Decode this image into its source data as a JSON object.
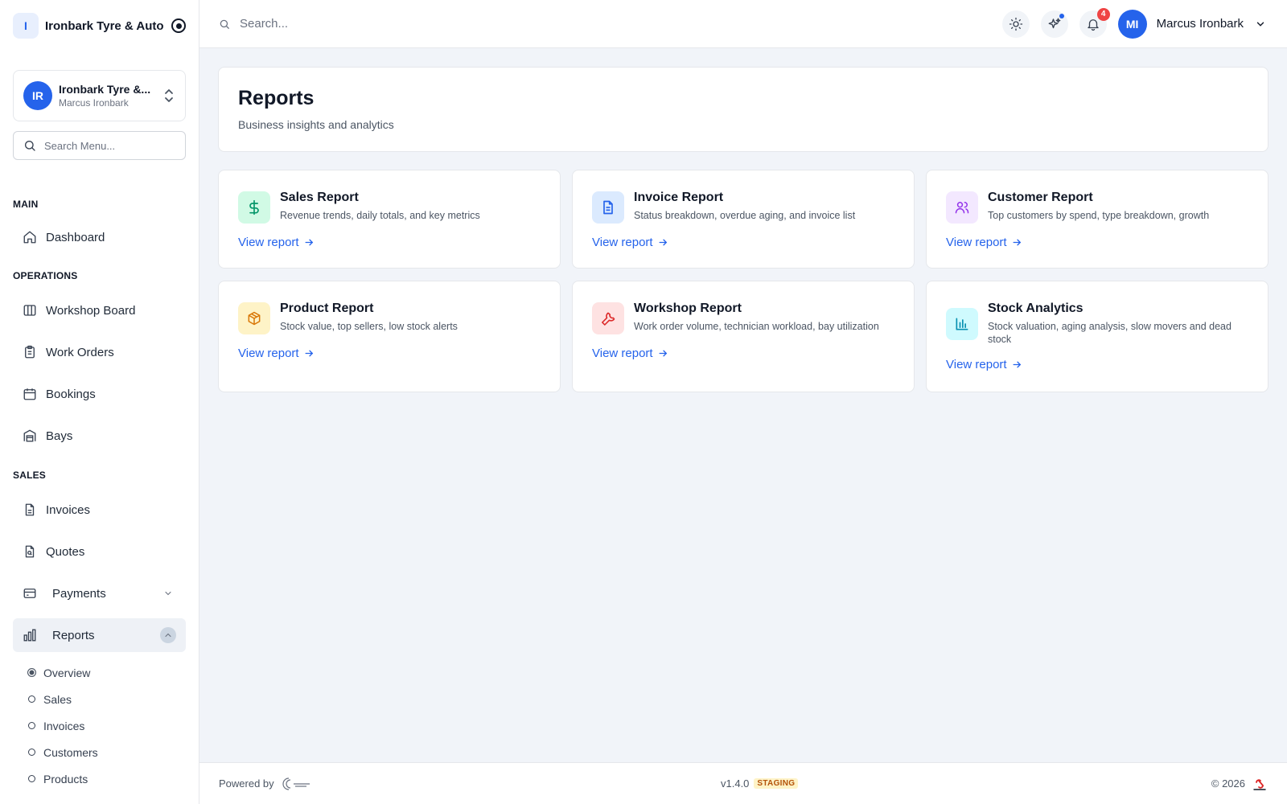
{
  "brand": {
    "logo_letter": "I",
    "name": "Ironbark Tyre & Auto"
  },
  "org_switcher": {
    "initials": "IR",
    "name": "Ironbark Tyre &...",
    "user": "Marcus Ironbark"
  },
  "menu_search": {
    "placeholder": "Search Menu..."
  },
  "sidebar": {
    "sections": {
      "main": "MAIN",
      "operations": "OPERATIONS",
      "sales": "SALES"
    },
    "items": {
      "dashboard": "Dashboard",
      "workshop_board": "Workshop Board",
      "work_orders": "Work Orders",
      "bookings": "Bookings",
      "bays": "Bays",
      "invoices": "Invoices",
      "quotes": "Quotes",
      "payments": "Payments",
      "reports": "Reports"
    },
    "report_subitems": [
      "Overview",
      "Sales",
      "Invoices",
      "Customers",
      "Products"
    ],
    "active_subitem": "Overview"
  },
  "topbar": {
    "search_placeholder": "Search...",
    "notification_count": "4",
    "user_initials": "MI",
    "user_name": "Marcus Ironbark"
  },
  "page": {
    "title": "Reports",
    "subtitle": "Business insights and analytics"
  },
  "report_cards": [
    {
      "title": "Sales Report",
      "description": "Revenue trends, daily totals, and key metrics",
      "link": "View report",
      "icon": "dollar-icon",
      "icon_bg": "#d1fae5",
      "icon_color": "#059669"
    },
    {
      "title": "Invoice Report",
      "description": "Status breakdown, overdue aging, and invoice list",
      "link": "View report",
      "icon": "document-icon",
      "icon_bg": "#dbeafe",
      "icon_color": "#2563eb"
    },
    {
      "title": "Customer Report",
      "description": "Top customers by spend, type breakdown, growth",
      "link": "View report",
      "icon": "users-icon",
      "icon_bg": "#f3e8ff",
      "icon_color": "#9333ea"
    },
    {
      "title": "Product Report",
      "description": "Stock value, top sellers, low stock alerts",
      "link": "View report",
      "icon": "package-icon",
      "icon_bg": "#fef3c7",
      "icon_color": "#d97706"
    },
    {
      "title": "Workshop Report",
      "description": "Work order volume, technician workload, bay utilization",
      "link": "View report",
      "icon": "wrench-icon",
      "icon_bg": "#fee2e2",
      "icon_color": "#dc2626"
    },
    {
      "title": "Stock Analytics",
      "description": "Stock valuation, aging analysis, slow movers and dead stock",
      "link": "View report",
      "icon": "bar-chart-icon",
      "icon_bg": "#cffafe",
      "icon_color": "#0891b2"
    }
  ],
  "footer": {
    "powered_by": "Powered by",
    "version": "v1.4.0",
    "environment": "STAGING",
    "copyright": "© 2026"
  },
  "colors": {
    "accent": "#2563eb",
    "background": "#f1f4f9",
    "badge": "#ef4444"
  }
}
